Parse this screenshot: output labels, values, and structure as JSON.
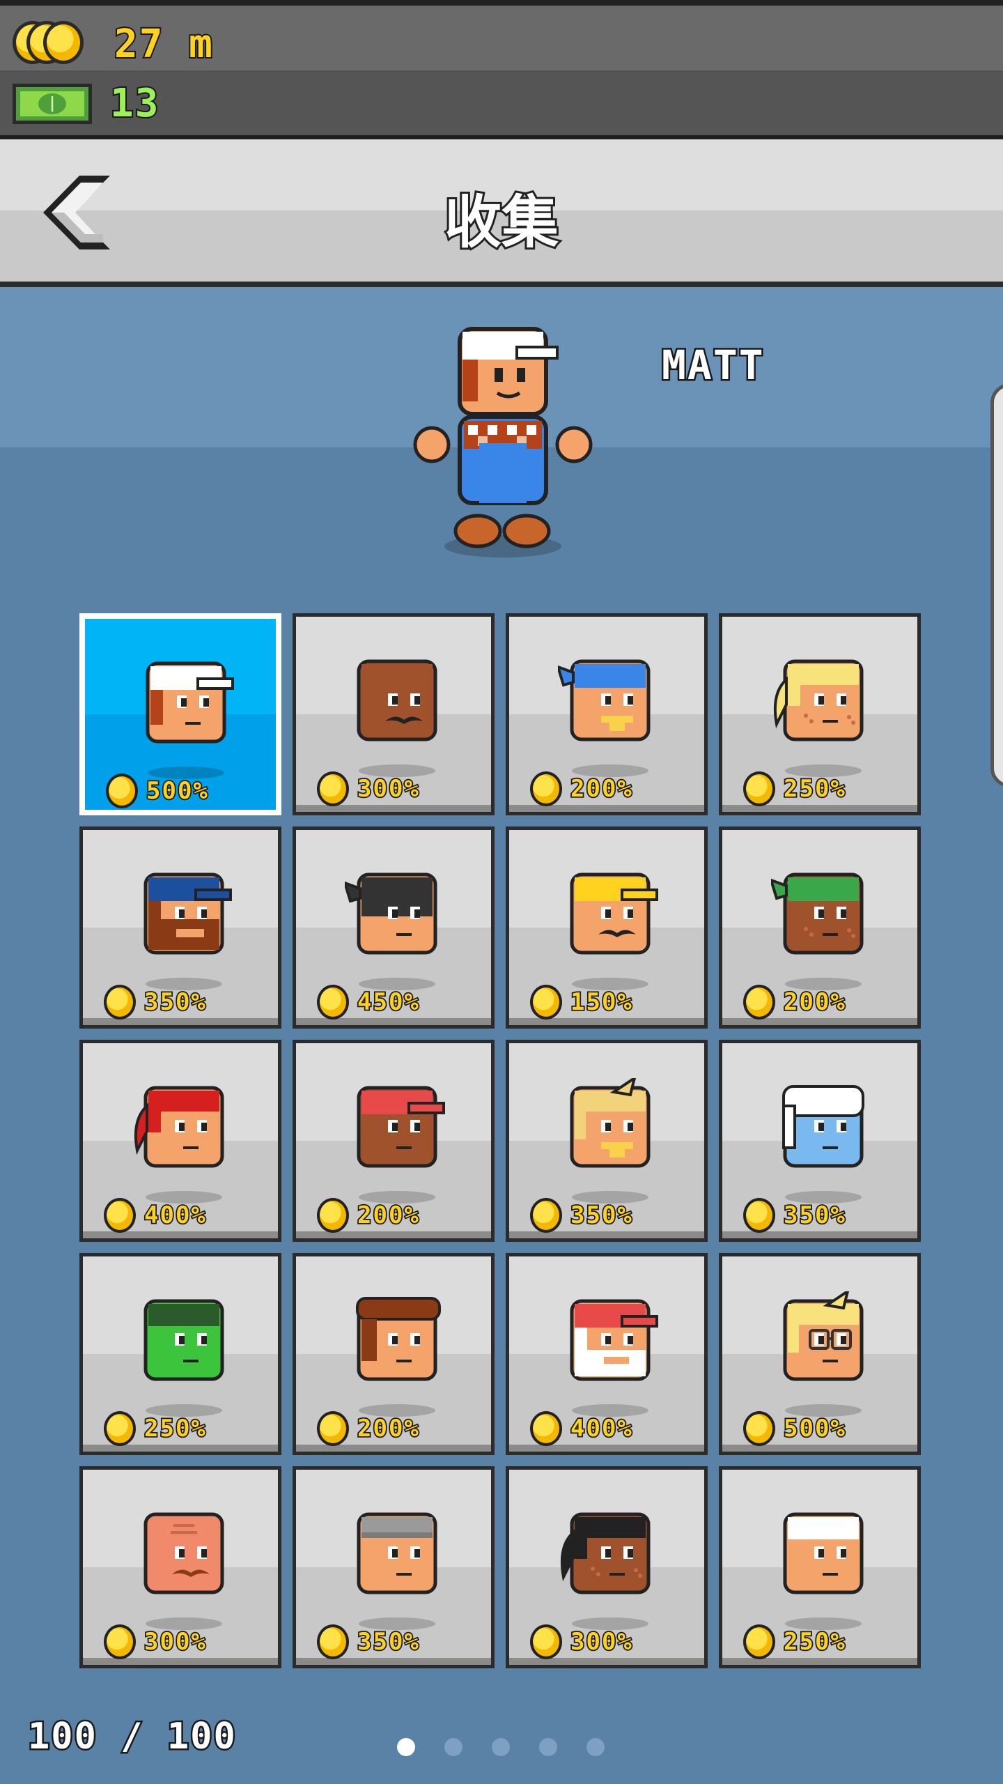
{
  "currency": {
    "coins": {
      "icon": "coins-icon",
      "value": "27 m"
    },
    "cash": {
      "icon": "cash-icon",
      "value": "13"
    }
  },
  "header": {
    "title": "收集",
    "back_icon": "chevron-left-icon"
  },
  "hero": {
    "name": "MATT"
  },
  "characters": [
    {
      "bonus": "500%",
      "skin": "#f4a46a",
      "hair": "#b5431a",
      "hat": "#ffffff",
      "hatType": "cap",
      "beard": "",
      "selected": true
    },
    {
      "bonus": "300%",
      "skin": "#a0522d",
      "hair": "#a0522d",
      "hat": "",
      "hatType": "none",
      "beard": "mustache"
    },
    {
      "bonus": "200%",
      "skin": "#f4a46a",
      "hair": "",
      "hat": "#3a86e8",
      "hatType": "bandana",
      "beard": "goatee-yellow"
    },
    {
      "bonus": "250%",
      "skin": "#f4a46a",
      "hair": "#f7e27c",
      "hat": "",
      "hatType": "ponytail",
      "beard": "freckles"
    },
    {
      "bonus": "350%",
      "skin": "#f4a46a",
      "hair": "#8a3a14",
      "hat": "#1c4f9e",
      "hatType": "cap",
      "beard": "full-beard"
    },
    {
      "bonus": "450%",
      "skin": "#f4a46a",
      "hair": "",
      "hat": "#333333",
      "hatType": "mask",
      "beard": ""
    },
    {
      "bonus": "150%",
      "skin": "#f4a46a",
      "hair": "",
      "hat": "#ffd21f",
      "hatType": "cap",
      "beard": "mustache"
    },
    {
      "bonus": "200%",
      "skin": "#a0522d",
      "hair": "",
      "hat": "#3aa84a",
      "hatType": "bandana",
      "beard": "freckles"
    },
    {
      "bonus": "400%",
      "skin": "#f4a46a",
      "hair": "#d61f1f",
      "hat": "",
      "hatType": "ponytail",
      "beard": ""
    },
    {
      "bonus": "200%",
      "skin": "#a0522d",
      "hair": "",
      "hat": "#e84a4a",
      "hatType": "cap",
      "beard": ""
    },
    {
      "bonus": "350%",
      "skin": "#f4a46a",
      "hair": "#f2d27a",
      "hat": "",
      "hatType": "spike",
      "beard": "goatee-yellow"
    },
    {
      "bonus": "350%",
      "skin": "#7ab8f0",
      "hair": "#ffffff",
      "hat": "",
      "hatType": "helmet",
      "beard": ""
    },
    {
      "bonus": "250%",
      "skin": "#3cc43c",
      "hair": "#2b5a2b",
      "hat": "",
      "hatType": "flat",
      "beard": ""
    },
    {
      "bonus": "200%",
      "skin": "#f4a46a",
      "hair": "#8a3a14",
      "hat": "",
      "hatType": "pomp",
      "beard": ""
    },
    {
      "bonus": "400%",
      "skin": "#f4a46a",
      "hair": "#ffffff",
      "hat": "#e84a4a",
      "hatType": "cap",
      "beard": "white-beard"
    },
    {
      "bonus": "500%",
      "skin": "#f4a46a",
      "hair": "#f7e27c",
      "hat": "",
      "hatType": "spike",
      "beard": "glasses"
    },
    {
      "bonus": "300%",
      "skin": "#f08a6a",
      "hair": "",
      "hat": "",
      "hatType": "bald",
      "beard": "mustache-brown"
    },
    {
      "bonus": "350%",
      "skin": "#f4a46a",
      "hair": "",
      "hat": "#9a9a9a",
      "hatType": "beanie",
      "beard": ""
    },
    {
      "bonus": "300%",
      "skin": "#a0522d",
      "hair": "#222222",
      "hat": "",
      "hatType": "ponytail",
      "beard": "freckles"
    },
    {
      "bonus": "250%",
      "skin": "#f4a46a",
      "hair": "#ffffff",
      "hat": "",
      "hatType": "flat",
      "beard": ""
    }
  ],
  "footer": {
    "count": "100 / 100",
    "pages": 5,
    "active_page": 1
  }
}
